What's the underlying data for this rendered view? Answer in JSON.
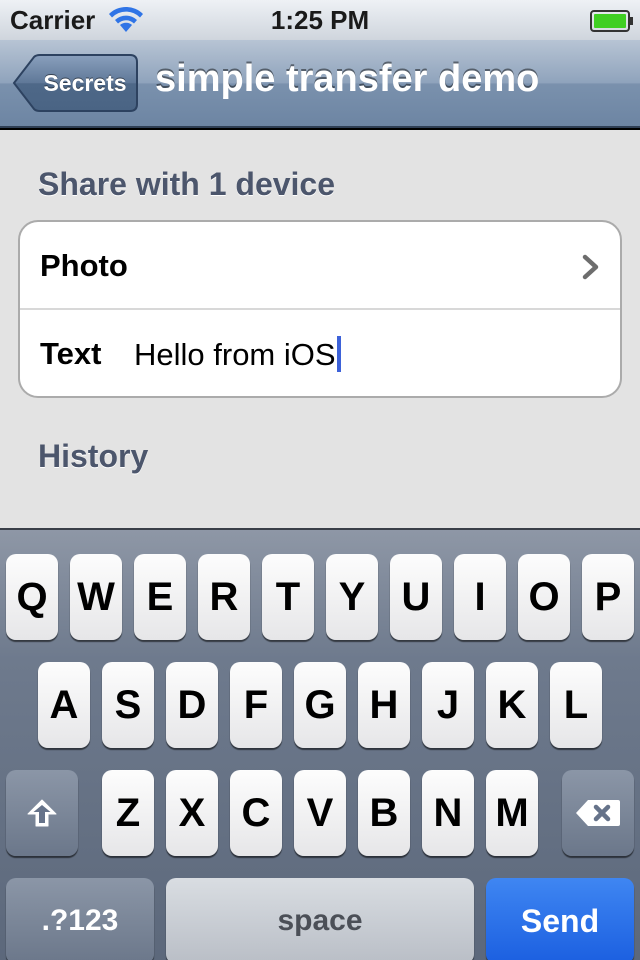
{
  "status_bar": {
    "carrier": "Carrier",
    "time": "1:25 PM",
    "wifi_icon": "wifi-icon",
    "battery_icon": "battery-full-icon"
  },
  "nav": {
    "back_label": "Secrets",
    "title": "simple transfer demo"
  },
  "content": {
    "share_header": "Share with 1 device",
    "rows": [
      {
        "label": "Photo",
        "icon": "chevron-right-icon"
      },
      {
        "label": "Text",
        "value": "Hello from iOS"
      }
    ],
    "history_header": "History"
  },
  "keyboard": {
    "row1": [
      "Q",
      "W",
      "E",
      "R",
      "T",
      "Y",
      "U",
      "I",
      "O",
      "P"
    ],
    "row2": [
      "A",
      "S",
      "D",
      "F",
      "G",
      "H",
      "J",
      "K",
      "L"
    ],
    "row3": [
      "Z",
      "X",
      "C",
      "V",
      "B",
      "N",
      "M"
    ],
    "shift_icon": "shift-icon",
    "delete_icon": "delete-icon",
    "numbers_label": ".?123",
    "space_label": "space",
    "send_label": "Send",
    "send_color": "#1f62e2"
  }
}
